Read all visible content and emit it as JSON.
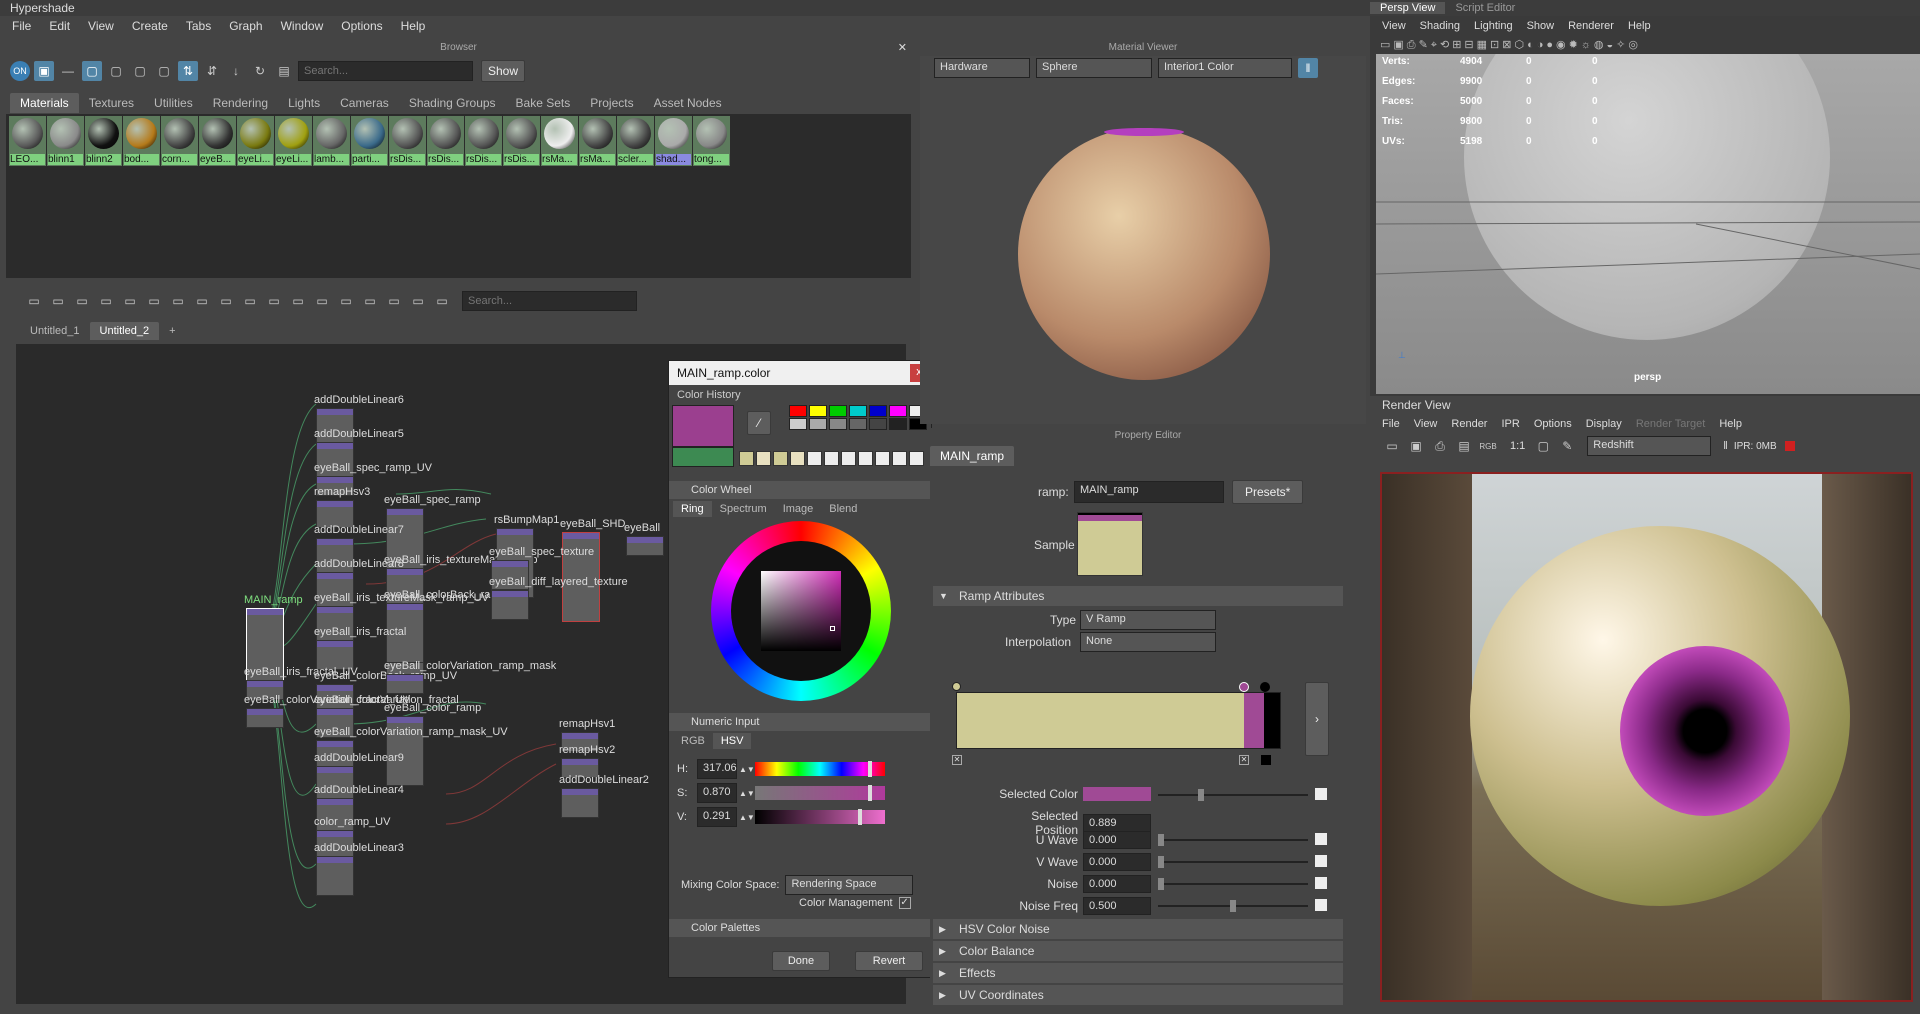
{
  "app": {
    "title": "Hypershade",
    "menu": [
      "File",
      "Edit",
      "View",
      "Create",
      "Tabs",
      "Graph",
      "Window",
      "Options",
      "Help"
    ]
  },
  "browser": {
    "title": "Browser",
    "search_placeholder": "Search...",
    "show_label": "Show",
    "tabs": [
      "Materials",
      "Textures",
      "Utilities",
      "Rendering",
      "Lights",
      "Cameras",
      "Shading Groups",
      "Bake Sets",
      "Projects",
      "Asset Nodes"
    ],
    "materials": [
      "LEO...",
      "blinn1",
      "blinn2",
      "bod...",
      "corn...",
      "eyeB...",
      "eyeLi...",
      "eyeLi...",
      "lamb...",
      "parti...",
      "rsDis...",
      "rsDis...",
      "rsDis...",
      "rsDis...",
      "rsMa...",
      "rsMa...",
      "scler...",
      "shad...",
      "tong..."
    ]
  },
  "graph": {
    "search_placeholder": "Search...",
    "tabs": [
      "Untitled_1",
      "Untitled_2",
      "+"
    ],
    "nodes": [
      "addDoubleLinear6",
      "addDoubleLinear5",
      "eyeBall_spec_ramp_UV",
      "remapHsv3",
      "eyeBall_spec_ramp",
      "addDoubleLinear7",
      "addDoubleLinear8",
      "eyeBall_iris_textureMask_ramp",
      "eyeBall_colorBack_ramp",
      "MAIN_ramp",
      "eyeBall_iris_textureMask_ramp_UV",
      "eyeBall_iris_fractal",
      "eyeBall_iris_fractal_UV",
      "eyeBall_colorBack_ramp_UV",
      "eyeBall_colorVariation_ramp_mask",
      "eyeBall_colorVariation_fractal_UV",
      "eyeBall_colorVariation_fractal",
      "eyeBall_color_ramp",
      "eyeBall_colorVariation_ramp_mask_UV",
      "addDoubleLinear9",
      "addDoubleLinear4",
      "color_ramp_UV",
      "addDoubleLinear3",
      "rsBumpMap1",
      "eyeBall_SHD",
      "eyeBall_spec_texture",
      "eyeBall_diff_layered_texture",
      "remapHsv1",
      "remapHsv2",
      "addDoubleLinear2",
      "eyeBall"
    ]
  },
  "color_dialog": {
    "title": "MAIN_ramp.color",
    "close": "x",
    "history_label": "Color History",
    "wheel_label": "Color Wheel",
    "wheel_tabs": [
      "Ring",
      "Spectrum",
      "Image",
      "Blend"
    ],
    "numeric_label": "Numeric Input",
    "num_tabs": [
      "RGB",
      "HSV"
    ],
    "h_label": "H:",
    "h_value": "317.06",
    "s_label": "S:",
    "s_value": "0.870",
    "v_label": "V:",
    "v_value": "0.291",
    "mixing_label": "Mixing Color Space:",
    "mixing_value": "Rendering Space",
    "cm_label": "Color Management",
    "palettes_label": "Color Palettes",
    "done": "Done",
    "revert": "Revert",
    "current_color": "#9b3f8f",
    "previous_color": "#3d8a52"
  },
  "material_viewer": {
    "title": "Material Viewer",
    "renderer": "Hardware",
    "shape": "Sphere",
    "env": "Interior1 Color"
  },
  "property_editor": {
    "title": "Property Editor",
    "node_tab": "MAIN_ramp",
    "ramp_label": "ramp:",
    "ramp_value": "MAIN_ramp",
    "presets": "Presets*",
    "sample_label": "Sample",
    "ramp_attrs": "Ramp Attributes",
    "type_label": "Type",
    "type_value": "V Ramp",
    "interp_label": "Interpolation",
    "interp_value": "None",
    "sel_color_label": "Selected Color",
    "sel_pos_label": "Selected Position",
    "sel_pos_value": "0.889",
    "uwave_label": "U Wave",
    "uwave_value": "0.000",
    "vwave_label": "V Wave",
    "vwave_value": "0.000",
    "noise_label": "Noise",
    "noise_value": "0.000",
    "noisefreq_label": "Noise Freq",
    "noisefreq_value": "0.500",
    "sections": [
      "HSV Color Noise",
      "Color Balance",
      "Effects",
      "UV Coordinates"
    ],
    "ramp_color_main": "#cfcb95",
    "ramp_color_sel": "#a04a95"
  },
  "persp": {
    "tabs": [
      "Persp View",
      "Script Editor"
    ],
    "menu": [
      "View",
      "Shading",
      "Lighting",
      "Show",
      "Renderer",
      "Help"
    ],
    "stats": [
      [
        "Verts:",
        "4904",
        "0",
        "0"
      ],
      [
        "Edges:",
        "9900",
        "0",
        "0"
      ],
      [
        "Faces:",
        "5000",
        "0",
        "0"
      ],
      [
        "Tris:",
        "9800",
        "0",
        "0"
      ],
      [
        "UVs:",
        "5198",
        "0",
        "0"
      ]
    ],
    "camera": "persp"
  },
  "render_view": {
    "title": "Render View",
    "menu": [
      "File",
      "View",
      "Render",
      "IPR",
      "Options",
      "Display",
      "Render Target",
      "Help"
    ],
    "ratio": "1:1",
    "renderer": "Redshift",
    "ipr": "IPR: 0MB"
  }
}
